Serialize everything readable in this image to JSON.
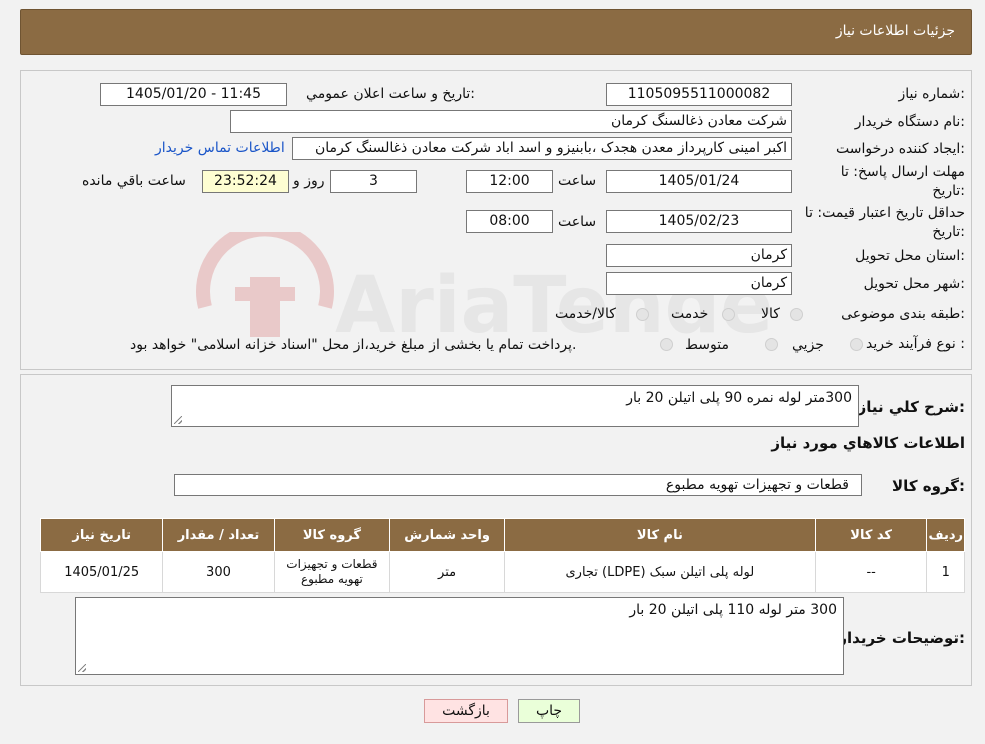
{
  "header": {
    "title": "جزئیات اطلاعات نیاز"
  },
  "fields": {
    "need_number_label": "شماره نیاز:",
    "need_number": "1105095511000082",
    "announce_label": "تاریخ و ساعت اعلان عمومي:",
    "announce_value": "1405/01/20 - 11:45",
    "buyer_org_label": "نام دستگاه خريدار:",
    "buyer_org": "شرکت معادن ذغالسنگ کرمان",
    "creator_label": "ايجاد کننده درخواست:",
    "creator": "اکبر امینی کارپرداز معدن هجدک ،بابنیزو و اسد اباد شرکت معادن ذغالسنگ کرمان",
    "contact_link": "اطلاعات تماس خریدار",
    "reply_deadline_label_1": "مهلت ارسال پاسخ: تا",
    "reply_deadline_label_2": "تاریخ:",
    "reply_date": "1405/01/24",
    "time_label": "ساعت",
    "reply_time": "12:00",
    "days": "3",
    "days_label": "روز و",
    "remaining_time": "23:52:24",
    "remaining_label": "ساعت باقي مانده",
    "price_validity_label_1": "حداقل تاریخ اعتبار قیمت: تا",
    "price_validity_label_2": "تاریخ:",
    "validity_date": "1405/02/23",
    "validity_time": "08:00",
    "province_label": "استان محل تحويل:",
    "province": "کرمان",
    "city_label": "شهر محل تحويل:",
    "city": "کرمان",
    "category_label": "طبقه بندی موضوعی:",
    "category_options": [
      "کالا",
      "خدمت",
      "کالا/خدمت"
    ],
    "process_label": "نوع فرآيند خريد :",
    "process_options": [
      "جزيي",
      "متوسط"
    ],
    "process_note": "پرداخت تمام يا بخشی از مبلغ خريد،از محل \"اسناد خزانه اسلامی\" خواهد بود."
  },
  "description": {
    "label": "شرح کلي نياز:",
    "text": "300متر لوله نمره 90 پلی اتیلن 20 بار"
  },
  "goods_info_title": "اطلاعات کالاهاي مورد نياز",
  "goods_group": {
    "label": "گروه کالا:",
    "value": "قطعات و تجهیزات تهویه مطبوع"
  },
  "table": {
    "headers": [
      "رديف",
      "کد کالا",
      "نام کالا",
      "واحد شمارش",
      "گروه کالا",
      "تعداد / مقدار",
      "تاريخ نياز"
    ],
    "rows": [
      [
        "1",
        "--",
        "لوله پلی اتیلن سبک (LDPE) تجاری",
        "متر",
        "قطعات و تجهیزات تهویه مطبوع",
        "300",
        "1405/01/25"
      ]
    ]
  },
  "buyer_notes": {
    "label": "توضيحات خريدار:",
    "text": "300 متر لوله 110 پلی اتیلن 20 بار"
  },
  "buttons": {
    "print": "چاپ",
    "back": "بازگشت"
  },
  "watermark": {
    "text": "AriaTender.neT"
  },
  "colors": {
    "header": "#8b6b43",
    "link": "#1a55c8",
    "print_bg": "#eaffd9",
    "back_bg": "#ffe3e3"
  }
}
